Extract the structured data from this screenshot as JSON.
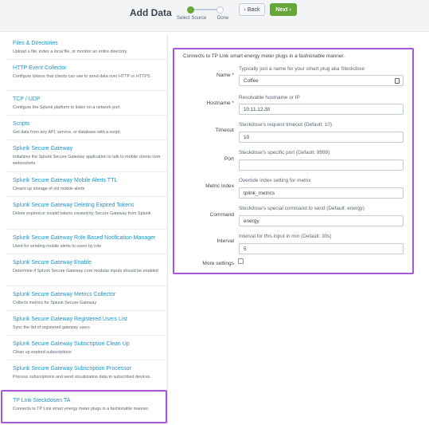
{
  "header": {
    "title": "Add Data",
    "steps": [
      "Select Source",
      "Done"
    ],
    "back_label": "Back",
    "next_label": "Next",
    "colors": {
      "accent": "#65a637",
      "highlight": "#a855d8",
      "link": "#1e93c6"
    }
  },
  "sidebar": {
    "items": [
      {
        "title": "Files & Directories",
        "desc": "Upload a file, index a local file, or monitor an entire directory."
      },
      {
        "title": "HTTP Event Collector",
        "desc": "Configure tokens that clients can use to send data over HTTP or HTTPS."
      },
      {
        "title": "TCP / UDP",
        "desc": "Configure the Splunk platform to listen on a network port."
      },
      {
        "title": "Scripts",
        "desc": "Get data from any API, service, or database with a script."
      },
      {
        "title": "Splunk Secure Gateway",
        "desc": "Initializes the Splunk Secure Gateway application to talk to mobile clients over websockets"
      },
      {
        "title": "Splunk Secure Gateway Mobile Alerts TTL",
        "desc": "Cleans up storage of old mobile alerts"
      },
      {
        "title": "Splunk Secure Gateway Deleting Expired Tokens",
        "desc": "Delete expired or invalid tokens created by Secure Gateway from Splunk"
      },
      {
        "title": "Splunk Secure Gateway Role Based Notification Manager",
        "desc": "Used for sending mobile alerts to users by role"
      },
      {
        "title": "Splunk Secure Gateway Enable",
        "desc": "Determine if Splunk Secure Gateway core modular inputs should be enabled"
      },
      {
        "title": "Splunk Secure Gateway Metrics Collector",
        "desc": "Collects metrics for Splunk Secure Gateway"
      },
      {
        "title": "Splunk Secure Gateway Registered Users List",
        "desc": "Sync the list of registered gateway users"
      },
      {
        "title": "Splunk Secure Gateway Subscription Clean Up",
        "desc": "Clean up expired subscriptions"
      },
      {
        "title": "Splunk Secure Gateway Subscription Processor",
        "desc": "Process subscriptions and send visualization data to subscribed devices."
      },
      {
        "title": "TP Link Steckdosen TA",
        "desc": "Connects to TP Link smart energy meter plugs in a fashionable manner."
      }
    ]
  },
  "form": {
    "description": "Connects to TP Link smart energy meter plugs in a fashionable manner.",
    "fields": [
      {
        "label": "Name *",
        "help": "Typically just a name for your smart plug aka Steckdose",
        "value": "Coffee",
        "icon": "keyboard-icon"
      },
      {
        "label": "Hostname *",
        "help": "Resolvable hostname or IP",
        "value": "10.11.12.30"
      },
      {
        "label": "Timeout",
        "help": "Steckdose's request timeout (Default: 10)",
        "value": "10"
      },
      {
        "label": "Port",
        "help": "Steckdose's specific port (Default: 9999)",
        "value": ""
      },
      {
        "label": "Metric Index",
        "help": "Override index setting for metrix",
        "value": "tplink_metrics"
      },
      {
        "label": "Command",
        "help": "Steckdose's special command to send (Default: energy)",
        "value": "energy"
      },
      {
        "label": "Interval",
        "help": "Interval for this input in min (Default: 30s)",
        "value": "5"
      }
    ],
    "more_settings_label": "More settings"
  }
}
